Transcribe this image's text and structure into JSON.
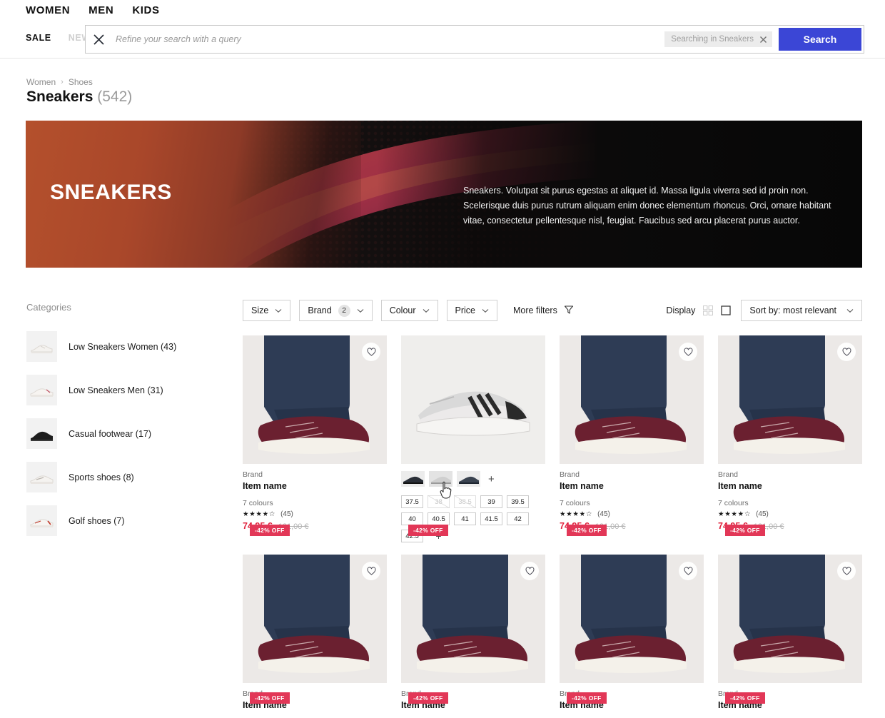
{
  "nav": {
    "primary": [
      {
        "label": "WOMEN",
        "active": true
      },
      {
        "label": "MEN",
        "active": false
      },
      {
        "label": "KIDS",
        "active": false
      }
    ],
    "secondary": [
      {
        "label": "SALE",
        "muted": false
      },
      {
        "label": "NEW",
        "muted": true
      }
    ]
  },
  "search": {
    "placeholder": "Refine your search with a query",
    "value": "",
    "scope_chip": "Searching in Sneakers",
    "button_label": "Search",
    "close_icon": "close-icon"
  },
  "breadcrumb": {
    "items": [
      "Women",
      "Shoes"
    ],
    "separator": "›"
  },
  "header": {
    "title": "Sneakers",
    "count": "(542)"
  },
  "hero": {
    "title": "SNEAKERS",
    "description": "Sneakers. Volutpat sit purus egestas at aliquet id. Massa ligula viverra sed id proin non. Scelerisque duis purus rutrum aliquam enim donec elementum rhoncus. Orci, ornare habitant vitae, consectetur pellentesque nisl, feugiat. Faucibus sed arcu placerat purus auctor.",
    "accent_color": "#b4502c",
    "background_color": "#0b0a0a"
  },
  "sidebar": {
    "title": "Categories",
    "items": [
      {
        "label": "Low Sneakers Women (43)"
      },
      {
        "label": "Low Sneakers Men (31)"
      },
      {
        "label": "Casual footwear (17)"
      },
      {
        "label": "Sports shoes (8)"
      },
      {
        "label": "Golf shoes (7)"
      }
    ]
  },
  "toolbar": {
    "filters": [
      {
        "label": "Size",
        "badge": ""
      },
      {
        "label": "Brand",
        "badge": "2"
      },
      {
        "label": "Colour",
        "badge": ""
      },
      {
        "label": "Price",
        "badge": ""
      }
    ],
    "more_filters_label": "More filters",
    "more_filters_icon": "funnel-icon",
    "display_label": "Display",
    "view_grid_icon": "grid-view-icon",
    "view_single_icon": "single-view-icon",
    "sort_label": "Sort by: most relevant",
    "sort_icon": "chevron-down-icon"
  },
  "products": {
    "row1": [
      {
        "brand": "Brand",
        "name": "Item name",
        "colours": "7 colours",
        "stars": "★★★★☆",
        "reviews": "(45)",
        "price_now": "74,95 €",
        "price_old": "121,00 €",
        "discount": "-42% OFF",
        "image": "burgundy-sneaker-on-foot"
      },
      {
        "brand": "",
        "name": "",
        "colours": "",
        "stars": "",
        "reviews": "",
        "price_now": "",
        "price_old": "",
        "discount": "-42% OFF",
        "image": "white-grey-retro-sneaker",
        "expanded": true,
        "swatches": [
          "variant-dark",
          "variant-light",
          "variant-navy"
        ],
        "swatch_plus": "+",
        "sizes": [
          {
            "label": "37.5",
            "available": true
          },
          {
            "label": "38",
            "available": false
          },
          {
            "label": "38.5",
            "available": false
          },
          {
            "label": "39",
            "available": true
          },
          {
            "label": "39.5",
            "available": true
          },
          {
            "label": "40",
            "available": true
          },
          {
            "label": "40.5",
            "available": true
          },
          {
            "label": "41",
            "available": true
          },
          {
            "label": "41.5",
            "available": true
          },
          {
            "label": "42",
            "available": true
          },
          {
            "label": "42.5",
            "available": true
          }
        ],
        "size_plus": "+"
      },
      {
        "brand": "Brand",
        "name": "Item name",
        "colours": "7 colours",
        "stars": "★★★★☆",
        "reviews": "(45)",
        "price_now": "74,95 €",
        "price_old": "121,00 €",
        "discount": "-42% OFF",
        "image": "burgundy-sneaker-on-foot"
      },
      {
        "brand": "Brand",
        "name": "Item name",
        "colours": "7 colours",
        "stars": "★★★★☆",
        "reviews": "(45)",
        "price_now": "74,95 €",
        "price_old": "121,00 €",
        "discount": "-42% OFF",
        "image": "burgundy-sneaker-on-foot"
      }
    ],
    "row2": [
      {
        "brand": "Brand",
        "name": "Item name",
        "discount": "-42% OFF",
        "image": "burgundy-sneaker-on-foot"
      },
      {
        "brand": "Brand",
        "name": "Item name",
        "discount": "-42% OFF",
        "image": "burgundy-sneaker-on-foot"
      },
      {
        "brand": "Brand",
        "name": "Item name",
        "discount": "-42% OFF",
        "image": "burgundy-sneaker-on-foot"
      },
      {
        "brand": "Brand",
        "name": "Item name",
        "discount": "-42% OFF",
        "image": "burgundy-sneaker-on-foot"
      }
    ]
  },
  "colors": {
    "accent_blue": "#3b46d6",
    "price_red": "#e0243f",
    "badge_red": "#e23757",
    "hero_orange": "#b4502c"
  }
}
